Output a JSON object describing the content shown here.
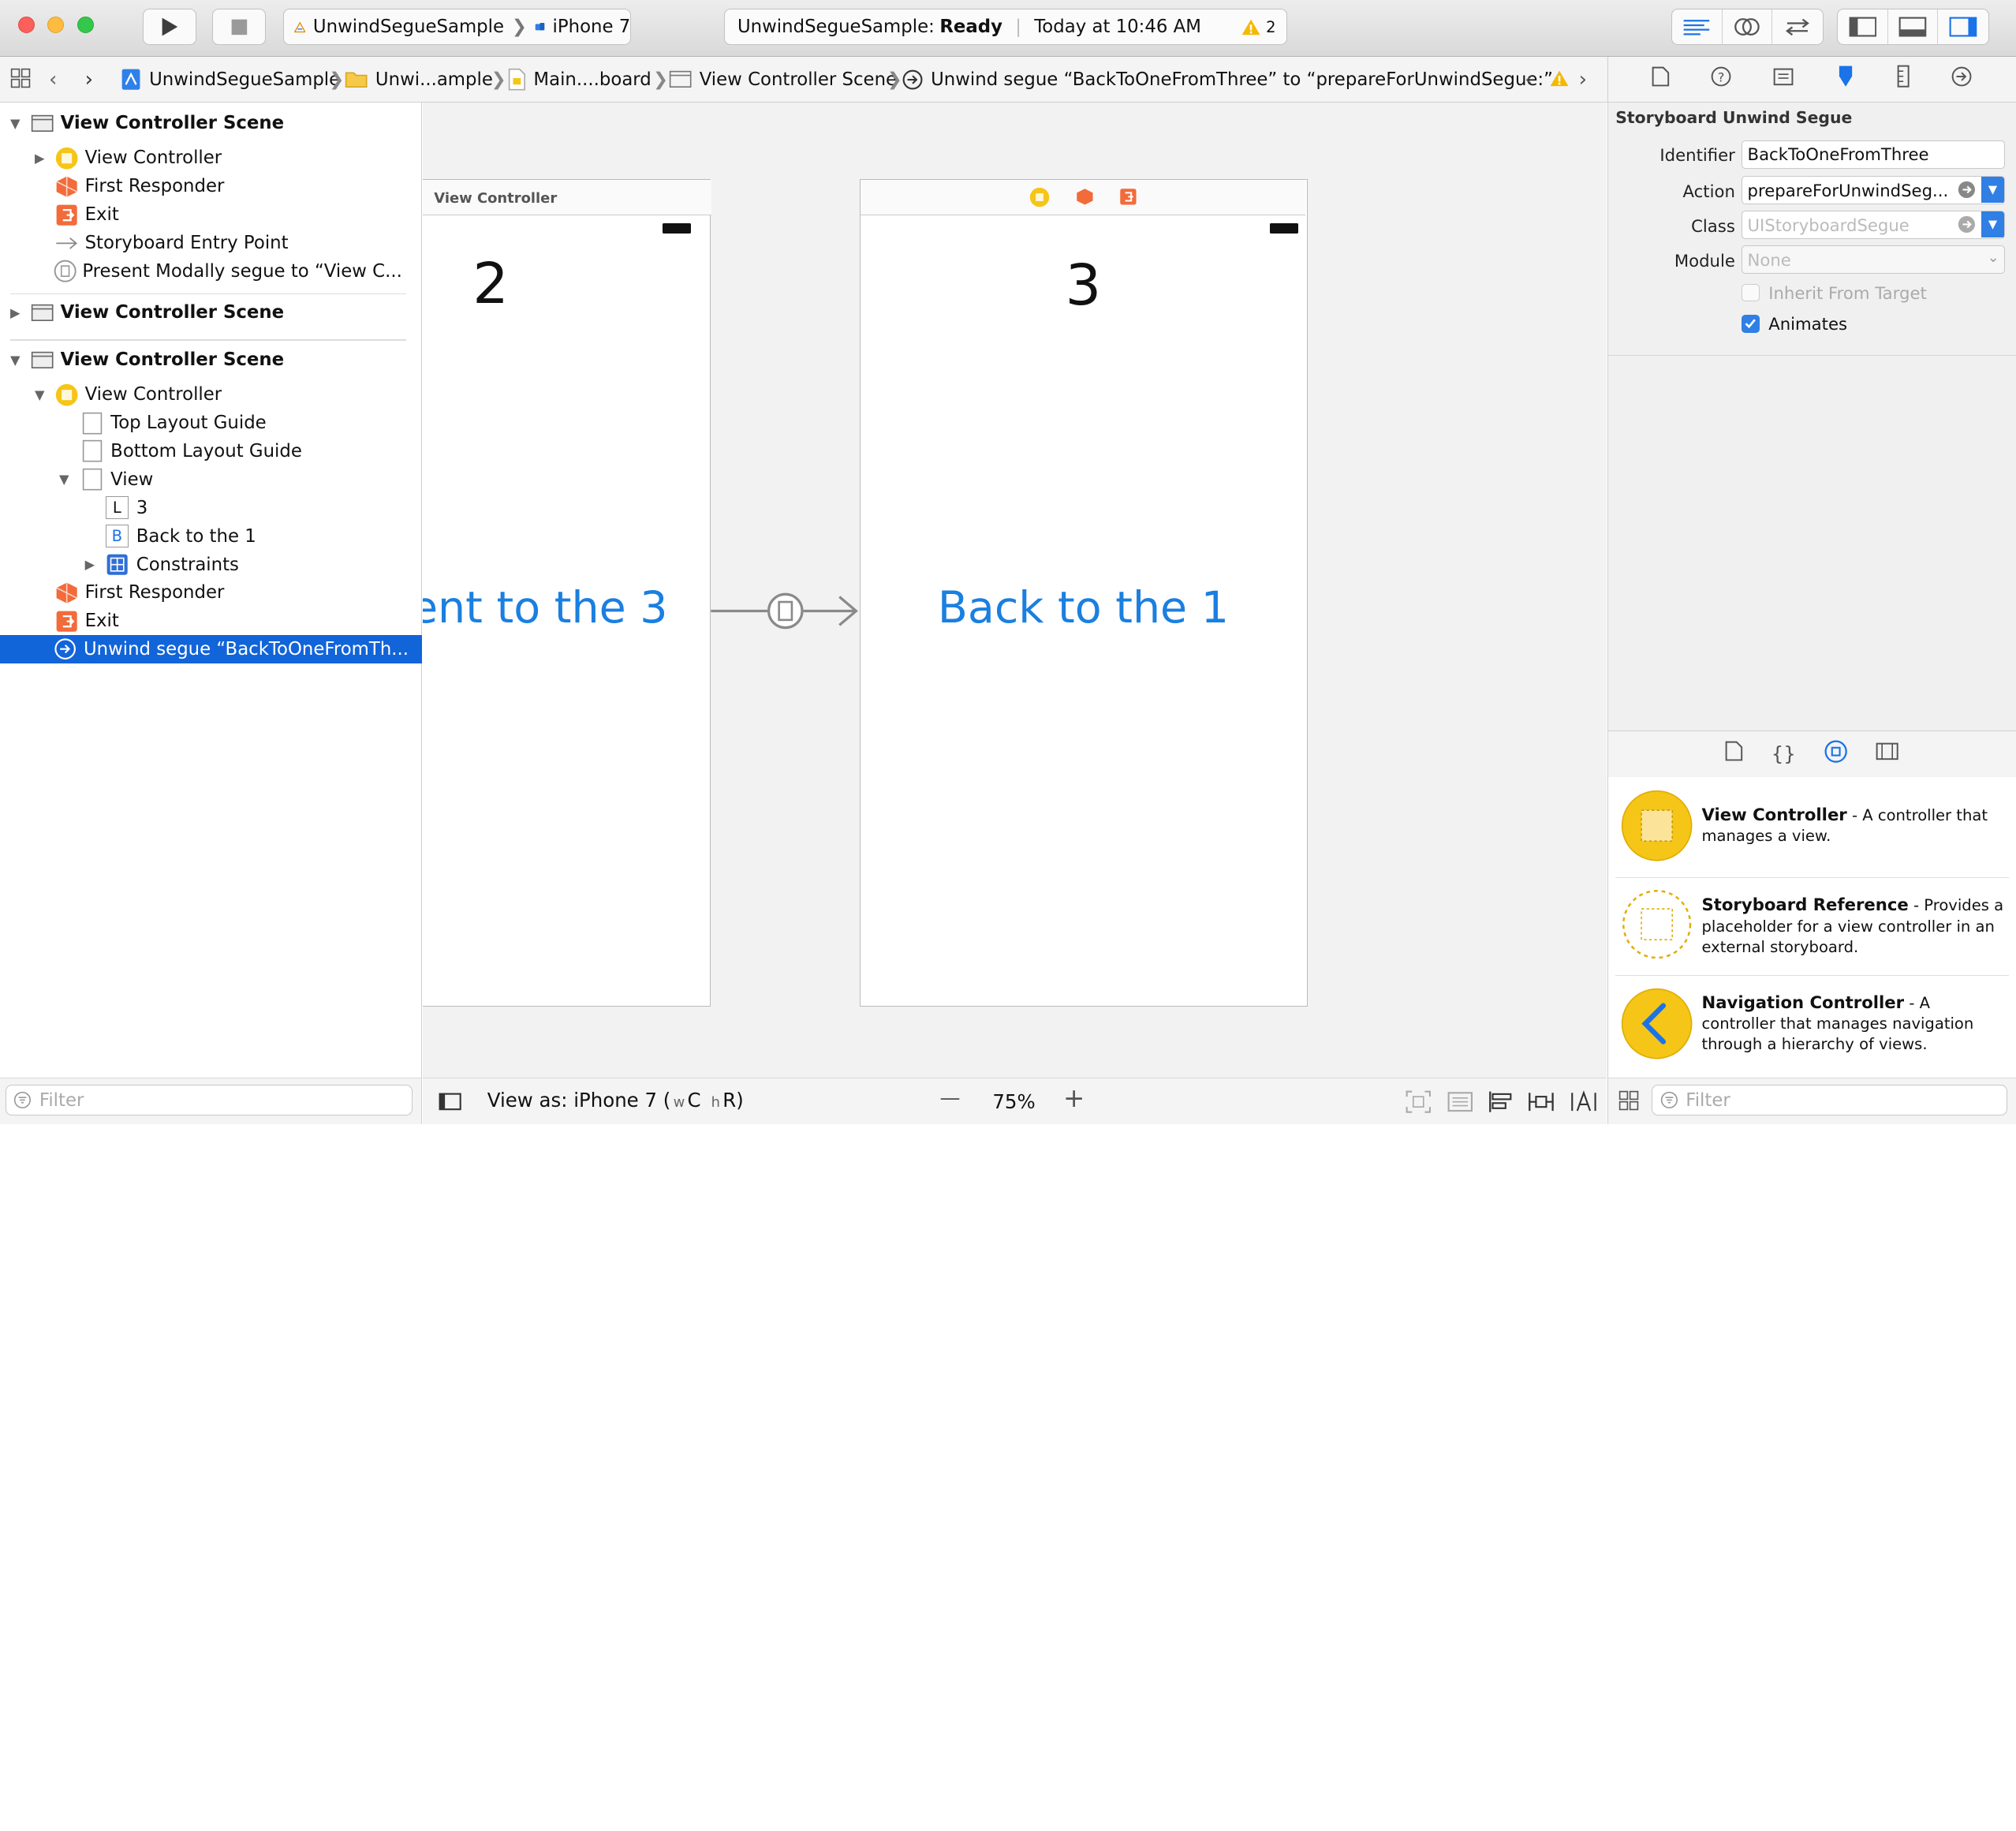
{
  "toolbar": {
    "scheme_name": "UnwindSegueSample",
    "device": "iPhone 7",
    "status_app": "UnwindSegueSample:",
    "status_state": "Ready",
    "status_time": "Today at 10:46 AM",
    "warning_count": "2"
  },
  "jumpbar": {
    "items": [
      "UnwindSegueSample",
      "Unwi...ample",
      "Main....board",
      "View Controller Scene",
      "Unwind segue “BackToOneFromThree” to “prepareForUnwindSegue:”"
    ]
  },
  "navigator": {
    "rows": [
      "View Controller Scene",
      "View Controller",
      "First Responder",
      "Exit",
      "Storyboard Entry Point",
      "Present Modally segue to “View C...",
      "View Controller Scene",
      "View Controller Scene",
      "View Controller",
      "Top Layout Guide",
      "Bottom Layout Guide",
      "View",
      "3",
      "Back to the 1",
      "Constraints",
      "First Responder",
      "Exit",
      "Unwind segue “BackToOneFromTh..."
    ],
    "label_badge": "L",
    "button_badge": "B",
    "filter_placeholder": "Filter"
  },
  "canvas": {
    "scene2_title": "View Controller",
    "scene2_label": "2",
    "scene2_button": "ent to the 3",
    "scene3_label": "3",
    "scene3_button": "Back to the 1",
    "view_as": "View as: iPhone 7 (",
    "size_w": "w",
    "size_c": "C",
    "size_h": "h",
    "size_r": "R)",
    "zoom": "75%",
    "zoom_out": "—",
    "zoom_in": "+"
  },
  "inspector": {
    "section_title": "Storyboard Unwind Segue",
    "identifier_label": "Identifier",
    "identifier_value": "BackToOneFromThree",
    "action_label": "Action",
    "action_value": "prepareForUnwindSeg...",
    "class_label": "Class",
    "class_placeholder": "UIStoryboardSegue",
    "module_label": "Module",
    "module_placeholder": "None",
    "inherit_label": "Inherit From Target",
    "animates_label": "Animates",
    "animates_checked": true
  },
  "library": {
    "items": [
      {
        "title": "View Controller",
        "desc1": " - A controller that",
        "desc2": "manages a view.",
        "desc3": ""
      },
      {
        "title": "Storyboard Reference",
        "desc1": " - Provides a",
        "desc2": "placeholder for a view controller in an",
        "desc3": "external storyboard."
      },
      {
        "title": "Navigation Controller",
        "desc1": " - A",
        "desc2": "controller that manages navigation",
        "desc3": "through a hierarchy of views."
      }
    ],
    "filter_placeholder": "Filter"
  },
  "colors": {
    "accent": "#1a73e8",
    "selection": "#1264d9",
    "ios_blue": "#1a7fe0",
    "yellow": "#f5c518",
    "orange": "#f26b3a",
    "warning": "#f5b800"
  }
}
